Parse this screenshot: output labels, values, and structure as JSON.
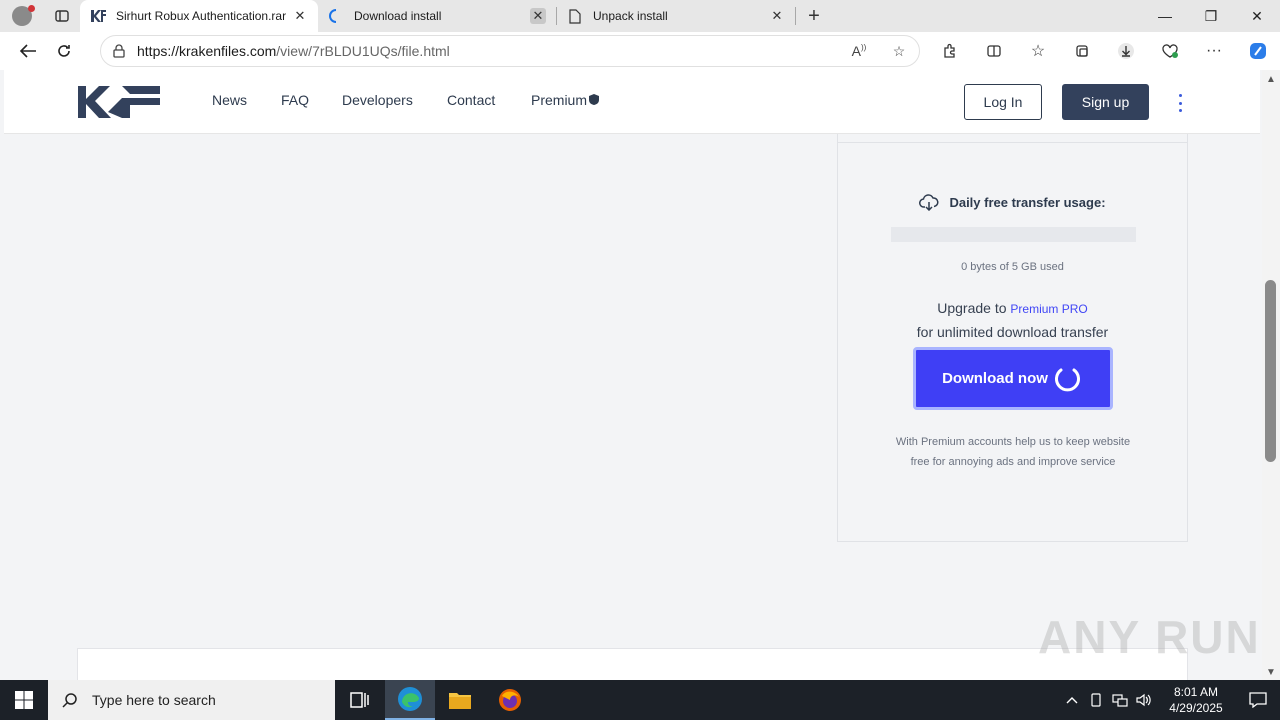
{
  "browser": {
    "tabs": [
      {
        "label": "Sirhurt Robux Authentication.rar",
        "active": true
      },
      {
        "label": "Download install",
        "active": false
      },
      {
        "label": "Unpack install",
        "active": false
      }
    ],
    "url_host": "https://krakenfiles.com",
    "url_path": "/view/7rBLDU1UQs/file.html"
  },
  "site": {
    "logo_text": "KF",
    "nav": [
      "News",
      "FAQ",
      "Developers",
      "Contact",
      "Premium"
    ],
    "login_label": "Log In",
    "signup_label": "Sign up"
  },
  "panel": {
    "usage_title": "Daily free transfer usage:",
    "usage_fraction": 0,
    "usage_text": "0 bytes of 5 GB used",
    "upgrade_prefix": "Upgrade to ",
    "upgrade_link": "Premium PRO",
    "upgrade_suffix": "for unlimited download transfer",
    "download_label": "Download now",
    "note": "With Premium accounts help us to keep website free for annoying ads and improve service"
  },
  "watermark": "ANY RUN",
  "taskbar": {
    "search_placeholder": "Type here to search",
    "time": "8:01 AM",
    "date": "4/29/2025"
  },
  "colors": {
    "accent": "#3f3ff5",
    "header_dark": "#33415c"
  }
}
